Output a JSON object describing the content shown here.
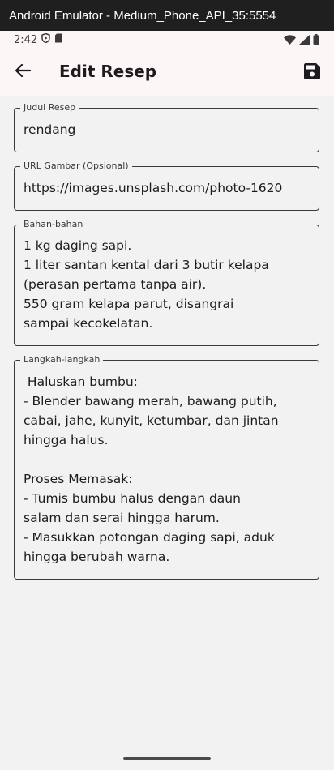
{
  "window": {
    "title": "Android Emulator - Medium_Phone_API_35:5554"
  },
  "status_bar": {
    "time": "2:42"
  },
  "app_bar": {
    "title": "Edit Resep"
  },
  "form": {
    "judul": {
      "label": "Judul Resep",
      "value": "rendang"
    },
    "url": {
      "label": "URL Gambar (Opsional)",
      "value": "https://images.unsplash.com/photo-1620"
    },
    "bahan": {
      "label": "Bahan-bahan",
      "value": "1 kg daging sapi.\n1 liter santan kental dari 3 butir kelapa\n(perasan pertama tanpa air).\n550 gram kelapa parut, disangrai\nsampai kecokelatan."
    },
    "langkah": {
      "label": "Langkah-langkah",
      "value": " Haluskan bumbu:\n- Blender bawang merah, bawang putih,\ncabai, jahe, kunyit, ketumbar, dan jintan\nhingga halus.\n\nProses Memasak:\n- Tumis bumbu halus dengan daun\nsalam dan serai hingga harum.\n- Masukkan potongan daging sapi, aduk\nhingga berubah warna."
    }
  },
  "icons": {
    "back": "arrow-back-icon",
    "save": "save-icon",
    "status": [
      "shield-icon",
      "sd-card-icon",
      "wifi-icon",
      "signal-icon",
      "battery-icon"
    ]
  },
  "colors": {
    "appbar_bg": "#fdf6f6",
    "page_bg": "#f3f2f2",
    "border": "#3a3a3a"
  }
}
